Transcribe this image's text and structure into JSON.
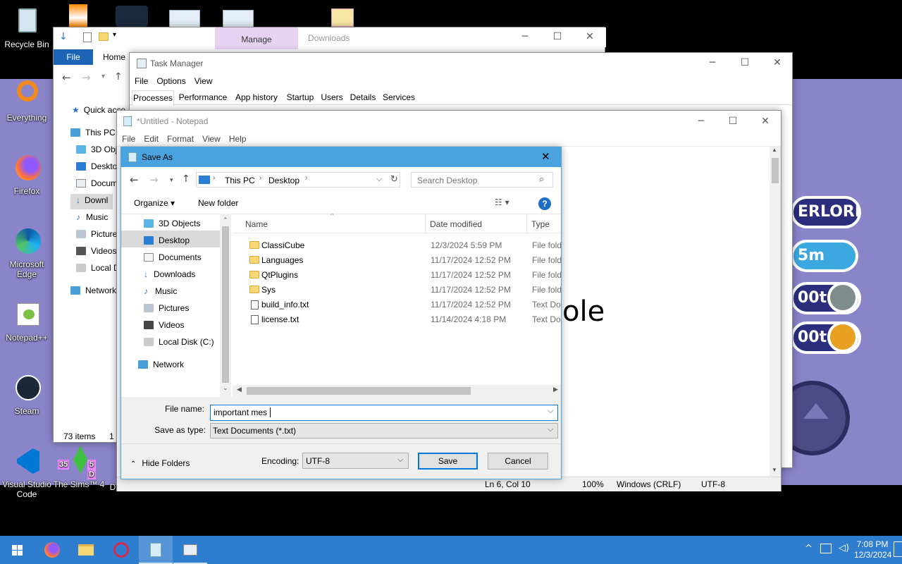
{
  "desktop": {
    "icons": [
      {
        "label": "Recycle Bin"
      },
      {
        "label": "Everything"
      },
      {
        "label": "Firefox"
      },
      {
        "label": "Microsoft Edge"
      },
      {
        "label": "Notepad++"
      },
      {
        "label": "Steam"
      },
      {
        "label": "Visual Studio Code"
      },
      {
        "label": "The Sims™ 4"
      },
      {
        "label": "D"
      }
    ]
  },
  "game_overlay": {
    "pill1": "ERLORD",
    "pill2": "5m",
    "pill3": "00t",
    "pill4": "00t",
    "badge1": "35",
    "badge2": "5 D"
  },
  "explorer": {
    "manage_tab": "Manage",
    "title": "Downloads",
    "ribbon_file": "File",
    "ribbon_home": "Home",
    "nav": [
      "Quick acce",
      "This PC",
      "3D Obj",
      "Deskto",
      "Docum",
      "Downl",
      "Music",
      "Picture",
      "Videos",
      "Local D",
      "Network"
    ],
    "status_items": "73 items",
    "status_sel": "1"
  },
  "taskmgr": {
    "title": "Task Manager",
    "menu": [
      "File",
      "Options",
      "View"
    ],
    "tabs": [
      "Processes",
      "Performance",
      "App history",
      "Startup",
      "Users",
      "Details",
      "Services"
    ]
  },
  "notepad": {
    "title": "*Untitled - Notepad",
    "menu": [
      "File",
      "Edit",
      "Format",
      "View",
      "Help"
    ],
    "body_text": "ole",
    "status": {
      "position": "Ln 6, Col 10",
      "zoom": "100%",
      "eol": "Windows (CRLF)",
      "encoding": "UTF-8"
    }
  },
  "saveas": {
    "title": "Save As",
    "breadcrumb": [
      "This PC",
      "Desktop"
    ],
    "search_placeholder": "Search Desktop",
    "organize": "Organize ▾",
    "new_folder": "New folder",
    "nav": [
      "3D Objects",
      "Desktop",
      "Documents",
      "Downloads",
      "Music",
      "Pictures",
      "Videos",
      "Local Disk (C:)",
      "Network"
    ],
    "columns": {
      "name": "Name",
      "date": "Date modified",
      "type": "Type"
    },
    "files": [
      {
        "name": "ClassiCube",
        "date": "12/3/2024 5:59 PM",
        "type": "File fold",
        "kind": "folder"
      },
      {
        "name": "Languages",
        "date": "11/17/2024 12:52 PM",
        "type": "File fold",
        "kind": "folder"
      },
      {
        "name": "QtPlugins",
        "date": "11/17/2024 12:52 PM",
        "type": "File fold",
        "kind": "folder"
      },
      {
        "name": "Sys",
        "date": "11/17/2024 12:52 PM",
        "type": "File fold",
        "kind": "folder"
      },
      {
        "name": "build_info.txt",
        "date": "11/17/2024 12:52 PM",
        "type": "Text Doc",
        "kind": "txt"
      },
      {
        "name": "license.txt",
        "date": "11/14/2024 4:18 PM",
        "type": "Text Doc",
        "kind": "txt"
      }
    ],
    "file_name_label": "File name:",
    "file_name_value": "important mes",
    "save_type_label": "Save as type:",
    "save_type_value": "Text Documents (*.txt)",
    "hide_folders": "Hide Folders",
    "encoding_label": "Encoding:",
    "encoding_value": "UTF-8",
    "save": "Save",
    "cancel": "Cancel"
  },
  "taskbar": {
    "time": "7:08 PM",
    "date": "12/3/2024"
  },
  "colors": {
    "taskbar": "#2e7dcf",
    "dialog_title": "#4aa3df",
    "wall": "#8a84c9",
    "select": "#cce8ff"
  }
}
